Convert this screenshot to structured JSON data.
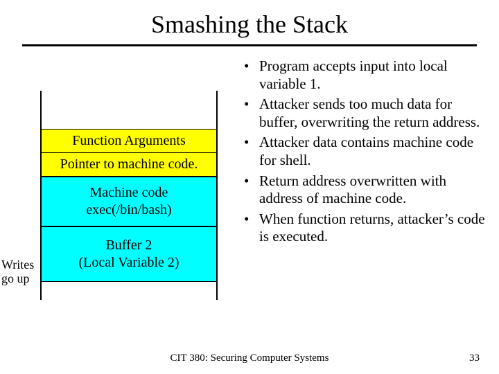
{
  "title": "Smashing the Stack",
  "side_label": "Writes go up",
  "stack": {
    "args": "Function Arguments",
    "ptr": "Pointer to machine code.",
    "mc_line1": "Machine code",
    "mc_line2": "exec(/bin/bash)",
    "buf_line1": "Buffer 2",
    "buf_line2": "(Local Variable 2)"
  },
  "bullets": [
    "Program accepts input into local variable 1.",
    "Attacker sends too much data for buffer, overwriting the return address.",
    "Attacker data contains machine code for shell.",
    "Return address overwritten with address of machine code.",
    "When function returns, attacker’s code is executed."
  ],
  "footer": {
    "course": "CIT 380: Securing Computer Systems",
    "page": "33"
  }
}
